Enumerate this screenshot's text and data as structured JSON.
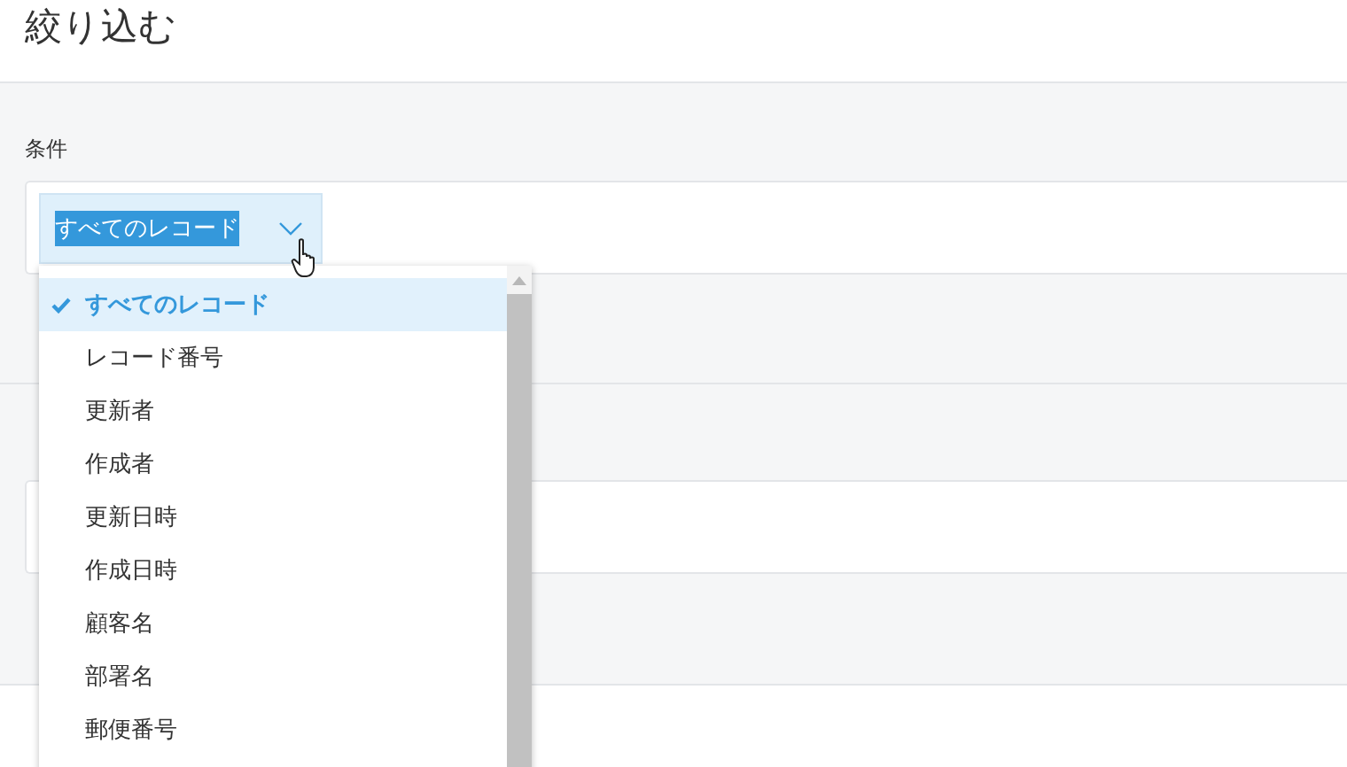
{
  "title": "絞り込む",
  "condition": {
    "label": "条件",
    "select": {
      "value": "すべてのレコード"
    }
  },
  "options": [
    {
      "label": "すべてのレコード",
      "selected": true
    },
    {
      "label": "レコード番号",
      "selected": false
    },
    {
      "label": "更新者",
      "selected": false
    },
    {
      "label": "作成者",
      "selected": false
    },
    {
      "label": "更新日時",
      "selected": false
    },
    {
      "label": "作成日時",
      "selected": false
    },
    {
      "label": "顧客名",
      "selected": false
    },
    {
      "label": "部署名",
      "selected": false
    },
    {
      "label": "郵便番号",
      "selected": false
    }
  ]
}
